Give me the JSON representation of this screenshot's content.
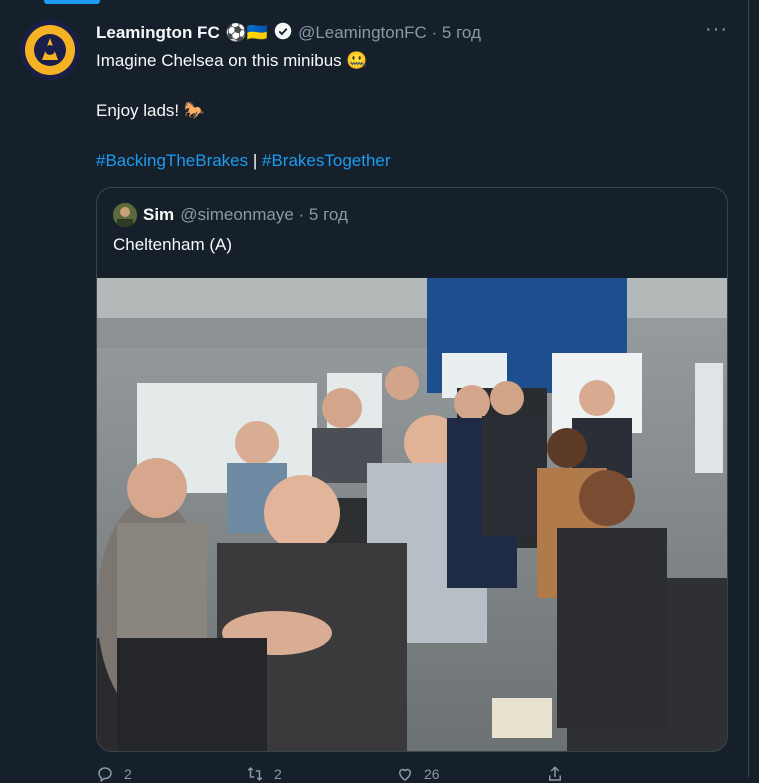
{
  "tweet": {
    "name": "Leamington FC",
    "badges": "⚽🇺🇦",
    "handle_time": "@LeamingtonFC · 5 год",
    "line1": "Imagine Chelsea on this minibus 🤐",
    "line2": "Enjoy lads! 🐎",
    "hashtag1": "#BackingTheBrakes",
    "separator": " | ",
    "hashtag2": "#BrakesTogether",
    "more": "···"
  },
  "quoted": {
    "name": "Sim",
    "handle_time": "@simeonmaye · 5 год",
    "text": "Cheltenham (A)"
  },
  "actions": {
    "reply_count": "2",
    "retweet_count": "2",
    "like_count": "26"
  },
  "colors": {
    "background": "#15202b",
    "accent": "#1d9bf0",
    "muted": "#8b98a5",
    "border": "#38444d"
  }
}
